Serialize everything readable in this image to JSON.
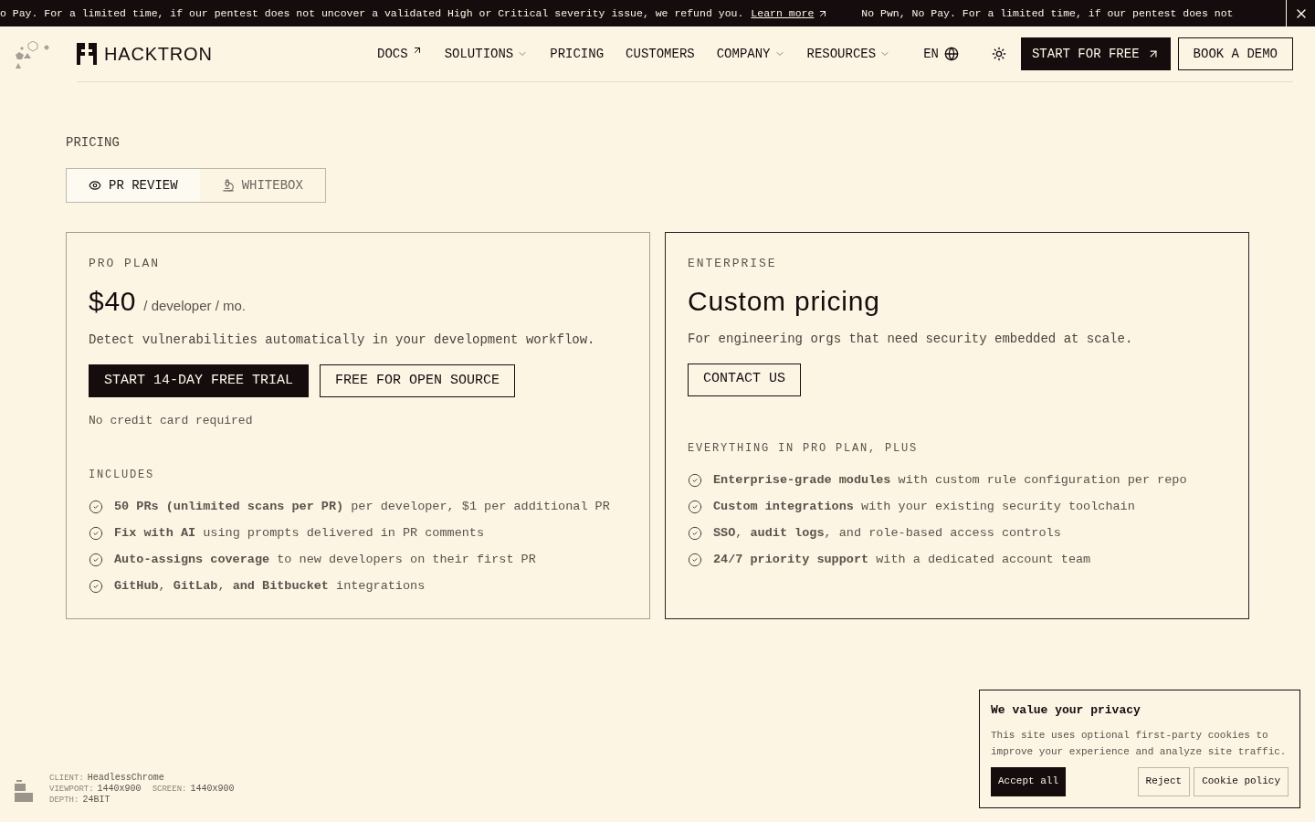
{
  "announcement": {
    "segments": [
      "o Pay. For a limited time, if our pentest does not uncover a validated High or Critical severity issue, we refund you.",
      "No Pwn, No Pay. For a limited time, if our pentest does not"
    ],
    "link": "Learn more"
  },
  "nav": {
    "brand": "HACKTRON",
    "items": [
      {
        "label": "DOCS",
        "kind": "external"
      },
      {
        "label": "SOLUTIONS",
        "kind": "dropdown"
      },
      {
        "label": "PRICING",
        "kind": "plain"
      },
      {
        "label": "CUSTOMERS",
        "kind": "plain"
      },
      {
        "label": "COMPANY",
        "kind": "dropdown"
      },
      {
        "label": "RESOURCES",
        "kind": "dropdown"
      }
    ],
    "language": "EN",
    "primary": "START FOR FREE",
    "secondary": "BOOK A DEMO"
  },
  "section_label": "PRICING",
  "tabs": [
    {
      "label": "PR REVIEW",
      "selected": true
    },
    {
      "label": "WHITEBOX",
      "selected": false
    }
  ],
  "plans": [
    {
      "highlighted": false,
      "eyebrow": "PRO PLAN",
      "price": "$40",
      "unit": "/ developer / mo.",
      "description": "Detect vulnerabilities automatically in your development workflow.",
      "buttons": [
        {
          "label": "START 14-DAY FREE TRIAL",
          "kind": "primary"
        },
        {
          "label": "FREE FOR OPEN SOURCE",
          "kind": "outline"
        }
      ],
      "note": "No credit card required",
      "features_heading": "INCLUDES",
      "features": [
        "**50 PRs (unlimited scans per PR)** per developer, $1 per additional PR",
        "**Fix with AI** using prompts delivered in PR comments",
        "**Auto-assigns coverage** to new developers on their first PR",
        "**GitHub**, **GitLab**, **and Bitbucket** integrations"
      ]
    },
    {
      "highlighted": true,
      "eyebrow": "ENTERPRISE",
      "price": "Custom pricing",
      "description": "For engineering orgs that need security embedded at scale.",
      "buttons": [
        {
          "label": "CONTACT US",
          "kind": "outline"
        }
      ],
      "features_heading": "EVERYTHING IN PRO PLAN, PLUS",
      "features": [
        "**Enterprise-grade modules** with custom rule configuration per repo",
        "**Custom integrations** with your existing security toolchain",
        "**SSO**, **audit logs**, and role-based access controls",
        "**24/7 priority support** with a dedicated account team"
      ]
    }
  ],
  "device_info": [
    {
      "label": "CLIENT:",
      "value": "HeadlessChrome"
    },
    {
      "label": "VIEWPORT:",
      "value": "1440x900"
    },
    {
      "label": "SCREEN:",
      "value": "1440x900"
    },
    {
      "label": "DEPTH:",
      "value": "24BIT"
    }
  ],
  "cookie": {
    "title": "We value your privacy",
    "text": "This site uses optional first-party cookies to improve your experience and analyze site traffic.",
    "buttons": [
      {
        "label": "Accept all",
        "kind": "primary"
      },
      {
        "label": "Reject",
        "kind": "outline"
      },
      {
        "label": "Cookie policy",
        "kind": "outline"
      }
    ]
  }
}
